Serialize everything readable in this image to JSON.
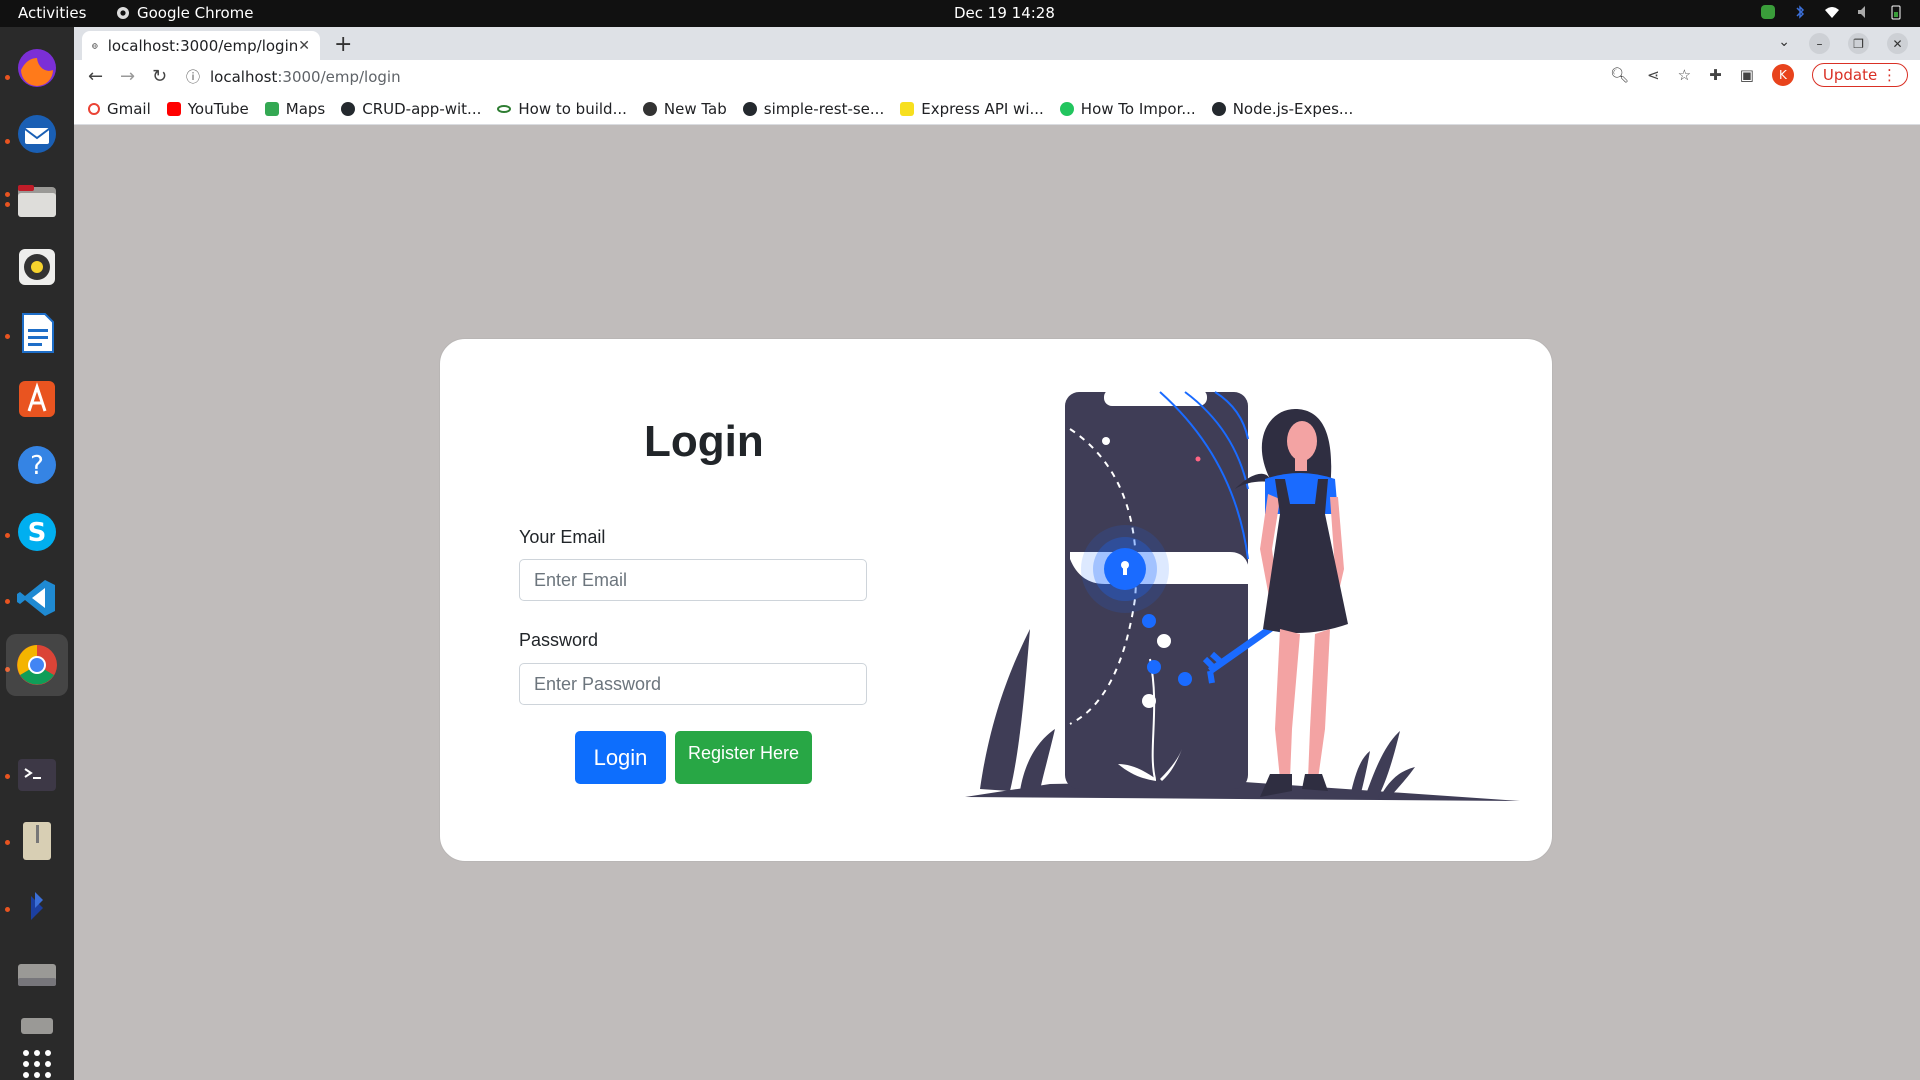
{
  "os": {
    "activities": "Activities",
    "app_name": "Google Chrome",
    "clock": "Dec 19  14:28"
  },
  "browser": {
    "tab_title": "localhost:3000/emp/login",
    "url_host": "localhost",
    "url_path": ":3000/emp/login",
    "profile_initial": "K",
    "update_label": "Update",
    "bookmarks": [
      {
        "label": "Gmail",
        "color": "#ea4335"
      },
      {
        "label": "YouTube",
        "color": "#ff0000"
      },
      {
        "label": "Maps",
        "color": "#34a853"
      },
      {
        "label": "CRUD-app-wit...",
        "color": "#24292e"
      },
      {
        "label": "How to build...",
        "color": "#2e7d32"
      },
      {
        "label": "New Tab",
        "color": "#333333"
      },
      {
        "label": "simple-rest-se...",
        "color": "#24292e"
      },
      {
        "label": "Express API wi...",
        "color": "#f7df1e"
      },
      {
        "label": "How To Impor...",
        "color": "#22c55e"
      },
      {
        "label": "Node.js-Expes...",
        "color": "#24292e"
      }
    ]
  },
  "page": {
    "title": "Login",
    "email_label": "Your Email",
    "email_placeholder": "Enter Email",
    "password_label": "Password",
    "password_placeholder": "Enter Password",
    "login_button": "Login",
    "register_button": "Register Here"
  },
  "colors": {
    "primary": "#0d6efd",
    "success": "#28a745",
    "illustration_dark": "#3f3d56",
    "illustration_accent": "#1a6bff",
    "illustration_skin": "#f3a3a3",
    "background": "#c0bcbb"
  }
}
